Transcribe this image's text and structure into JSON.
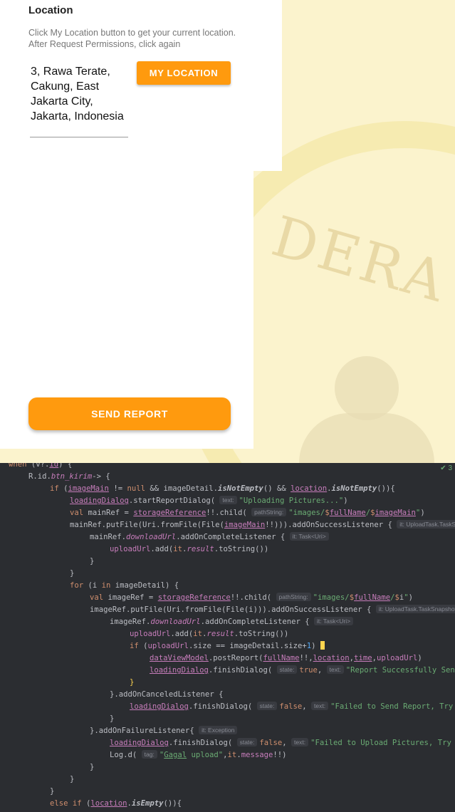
{
  "app": {
    "location_title": "Location",
    "location_hint": "Click My Location button to get your current location. After Request Permissions, click again",
    "address": "3, Rawa Terate, Cakung, East Jakarta City, Jakarta, Indonesia",
    "my_location_button": "MY LOCATION",
    "send_report_button": "SEND REPORT"
  },
  "editor": {
    "inspection_indicator": "✔ 3",
    "lines": [
      "when (v?.id) {",
      "R.id.btn_kirim-> {",
      "if (imageMain != null && imageDetail.isNotEmpty() && location.isNotEmpty()){",
      "loadingDialog.startReportDialog( text: \"Uploading Pictures...\")",
      "val mainRef = storageReference!!.child( pathString: \"images/$fullName/$imageMain\")",
      "mainRef.putFile(Uri.fromFile(File(imageMain!!))).addOnSuccessListener { it: UploadTask.TaskSna",
      "mainRef.downloadUrl.addOnCompleteListener { it: Task<Uri>",
      "uploadUrl.add(it.result.toString())",
      "}",
      "}",
      "for (i in imageDetail) {",
      "val imageRef = storageReference!!.child( pathString: \"images/$fullName/$i\")",
      "imageRef.putFile(Uri.fromFile(File(i))).addOnSuccessListener { it: UploadTask.TaskSnapshot!",
      "imageRef.downloadUrl.addOnCompleteListener { it: Task<Uri>",
      "uploadUrl.add(it.result.toString())",
      "if (uploadUrl.size == imageDetail.size+1) {",
      "dataViewModel.postReport(fullName!!,location,time,uploadUrl)",
      "loadingDialog.finishDialog( state: true, text: \"Report Successfully Send\")",
      "}",
      "}.addOnCanceledListener {",
      "loadingDialog.finishDialog( state: false, text: \"Failed to Send Report, Try Again",
      "}",
      "}.addOnFailureListener{ it: Exception",
      "loadingDialog.finishDialog( state: false, text: \"Failed to Upload Pictures, Try Again",
      "Log.d( tag: \"Gagal upload\",it.message!!)",
      "}",
      "}",
      "}",
      "else if (location.isEmpty()){"
    ]
  }
}
